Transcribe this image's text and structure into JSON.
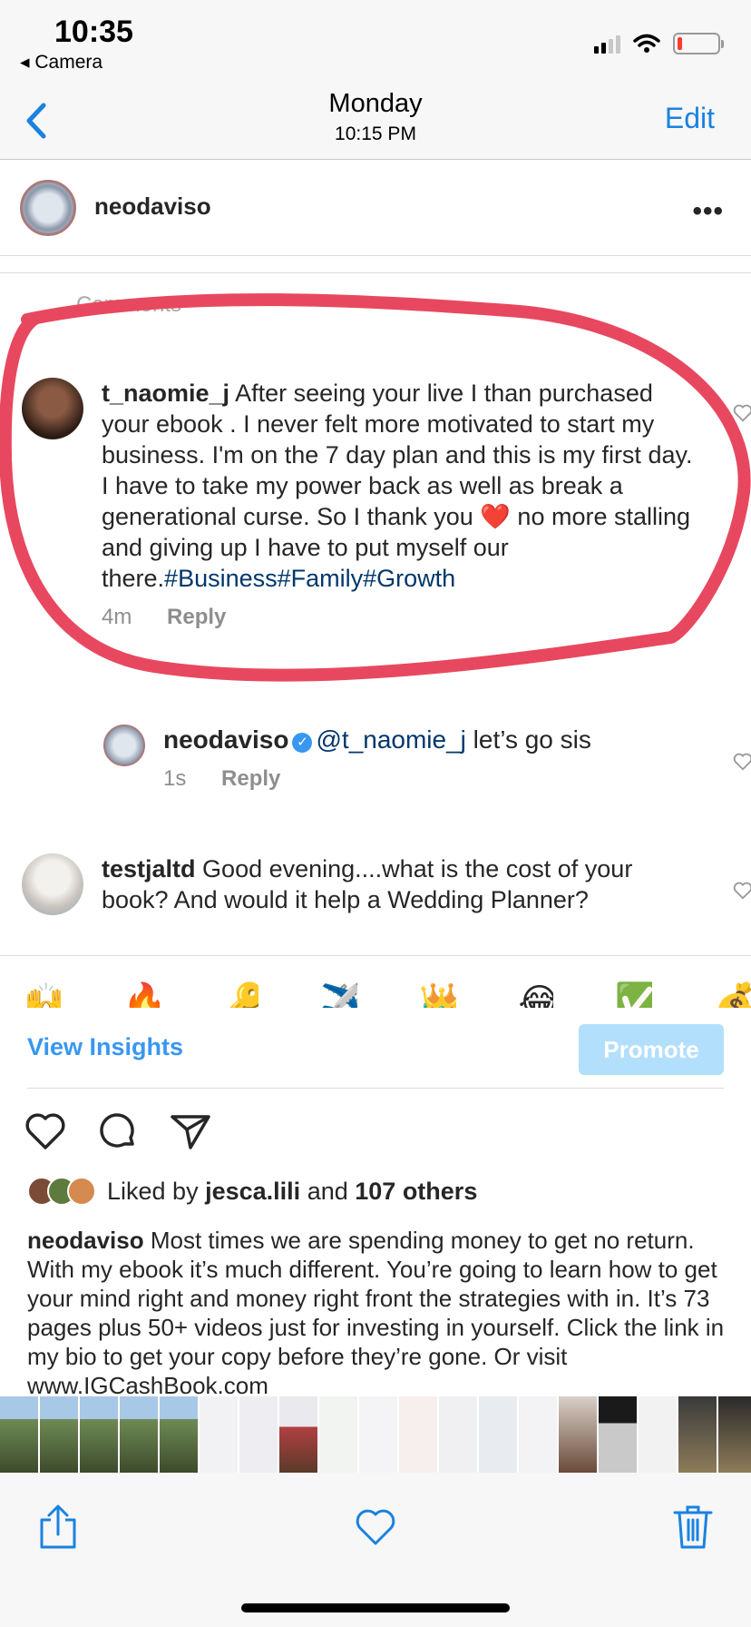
{
  "status_bar": {
    "time": "10:35",
    "back_app": "◂ Camera"
  },
  "photos_nav": {
    "title": "Monday",
    "subtitle": "10:15 PM",
    "edit_label": "Edit",
    "accent_color": "#1a82e0"
  },
  "post": {
    "username": "neodaviso",
    "comments_header": "Comments",
    "comments": [
      {
        "user": "t_naomie_j",
        "text_before_emoji": "After seeing your live I than purchased your ebook . I never felt more motivated to start my business. I'm on the 7 day plan and this is my first day. I have to take my power back as well as  break a generational curse. So I thank you",
        "emoji": "❤️",
        "text_after_emoji": "no more stalling and giving up I have to put myself our there.",
        "hashtags": "#Business#Family#Growth",
        "time": "4m",
        "reply_label": "Reply"
      },
      {
        "user": "neodaviso",
        "mention": "@t_naomie_j",
        "text": "let’s go sis",
        "time": "1s",
        "reply_label": "Reply"
      },
      {
        "user": "testjaltd",
        "text": "Good evening....what is the cost of your book? And would it help a Wedding Planner?"
      }
    ],
    "quick_emojis": [
      "🙌",
      "🔥",
      "🔑",
      "✈️",
      "👑",
      "😂",
      "✅",
      "💰"
    ],
    "view_insights_label": "View Insights",
    "promote_label": "Promote",
    "likes": {
      "prefix": "Liked by",
      "user": "jesca.lili",
      "middle": "and",
      "others": "107 others"
    },
    "caption_user": "neodaviso",
    "caption_text": "Most times we are spending money to get no return. With my ebook it’s much different. You’re going to learn how to get your mind right and money right front the strategies with in. It’s 73 pages plus 50+ videos just for investing in yourself. Click the link in my bio to get your copy before they’re gone. Or visit www.IGCashBook.com"
  },
  "colors": {
    "highlight": "#e8485f",
    "insights_blue": "#3897f0",
    "promote_bg": "#b2dffc"
  }
}
